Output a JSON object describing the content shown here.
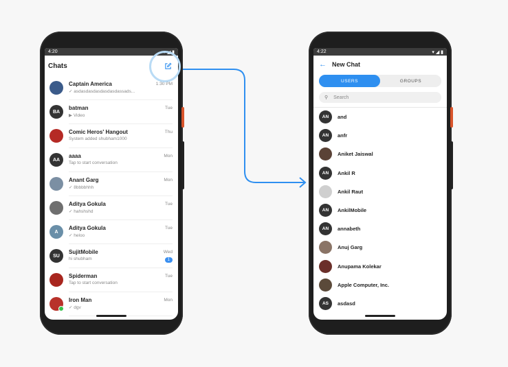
{
  "left_phone": {
    "status_time": "4:20",
    "title": "Chats",
    "chats": [
      {
        "name": "Captain America",
        "message": "asdasdasdasdasdasdassads...",
        "time": "1:30 PM",
        "initials": "",
        "color": "#3b5b8a",
        "ticks": true
      },
      {
        "name": "batman",
        "message": "Video",
        "time": "Tue",
        "initials": "BA",
        "color": "#333333",
        "video": true
      },
      {
        "name": "Comic Heros' Hangout",
        "message": "System added shubham1000",
        "time": "Thu",
        "initials": "",
        "color": "#b52a25"
      },
      {
        "name": "aaaa",
        "message": "Tap to start conversation",
        "time": "Mon",
        "initials": "AA",
        "color": "#333333"
      },
      {
        "name": "Anant Garg",
        "message": "8bbbbhhh",
        "time": "Mon",
        "initials": "",
        "color": "#7b8fa3",
        "ticks": true
      },
      {
        "name": "Aditya Gokula",
        "message": "hahshshd",
        "time": "Tue",
        "initials": "",
        "color": "#6f6f6f",
        "ticks": true
      },
      {
        "name": "Aditya Gokula",
        "message": "heloo",
        "time": "Tue",
        "initials": "A",
        "color": "#6a8fa8",
        "ticks": true
      },
      {
        "name": "SujitMobile",
        "message": "hi shubham",
        "time": "Wed",
        "initials": "SU",
        "color": "#333333",
        "badge": "1"
      },
      {
        "name": "Spiderman",
        "message": "Tap to start conversation",
        "time": "Tue",
        "initials": "",
        "color": "#a8261e"
      },
      {
        "name": "Iron Man",
        "message": "dgv",
        "time": "Mon",
        "initials": "",
        "color": "#b8322a",
        "ticks": true,
        "online": true
      }
    ]
  },
  "right_phone": {
    "status_time": "4:22",
    "title": "New Chat",
    "tabs": [
      "USERS",
      "GROUPS"
    ],
    "active_tab": "USERS",
    "search_placeholder": "Search",
    "users": [
      {
        "name": "and",
        "initials": "AN",
        "color": "#333333"
      },
      {
        "name": "anfr",
        "initials": "AN",
        "color": "#333333"
      },
      {
        "name": "Aniket Jaiswal",
        "initials": "",
        "color": "#5a4236"
      },
      {
        "name": "Ankil R",
        "initials": "AN",
        "color": "#333333"
      },
      {
        "name": "Ankil Raut",
        "initials": "",
        "color": "#cfcfcf"
      },
      {
        "name": "AnkilMobile",
        "initials": "AN",
        "color": "#333333"
      },
      {
        "name": "annabeth",
        "initials": "AN",
        "color": "#333333"
      },
      {
        "name": "Anuj Garg",
        "initials": "",
        "color": "#8a7466"
      },
      {
        "name": "Anupama Kolekar",
        "initials": "",
        "color": "#6b2f2a"
      },
      {
        "name": "Apple Computer, Inc.",
        "initials": "",
        "color": "#5b4a3a"
      },
      {
        "name": "asdasd",
        "initials": "AS",
        "color": "#333333"
      }
    ]
  },
  "colors": {
    "accent": "#2e8ff0",
    "arrow": "#2e8ff0"
  }
}
